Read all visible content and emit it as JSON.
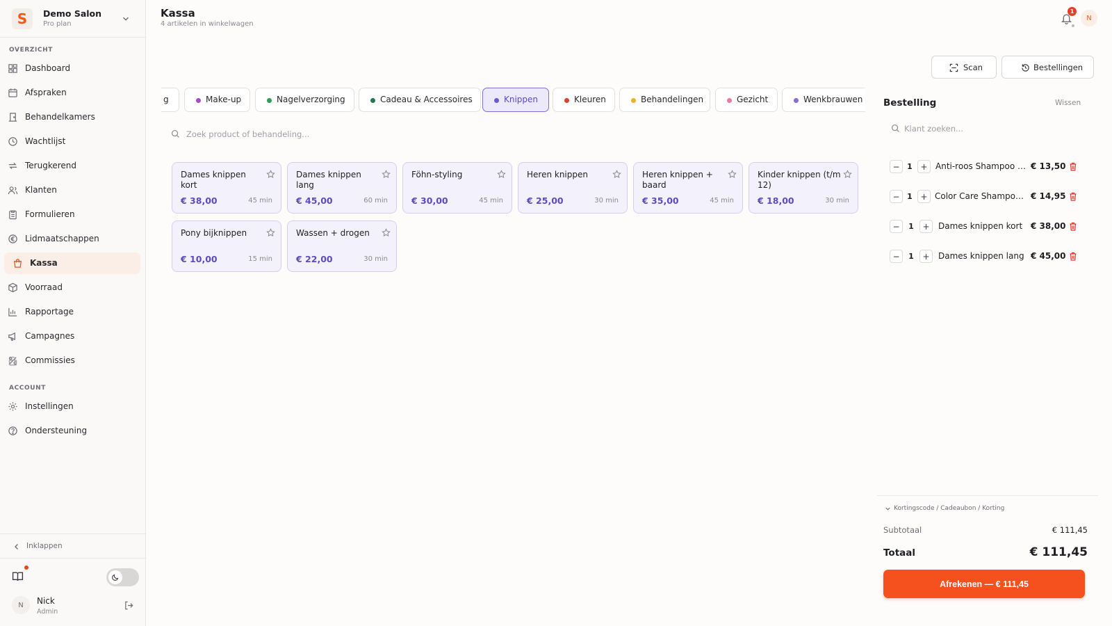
{
  "brand": {
    "logo_letter": "S",
    "name": "Demo Salon",
    "plan": "Pro plan"
  },
  "sidebar": {
    "section_overview": "OVERZICHT",
    "section_account": "ACCOUNT",
    "items": [
      {
        "label": "Dashboard",
        "icon": "dashboard-icon"
      },
      {
        "label": "Afspraken",
        "icon": "calendar-icon"
      },
      {
        "label": "Behandelkamers",
        "icon": "door-icon"
      },
      {
        "label": "Wachtlijst",
        "icon": "clock-icon"
      },
      {
        "label": "Terugkerend",
        "icon": "repeat-icon"
      },
      {
        "label": "Klanten",
        "icon": "users-icon"
      },
      {
        "label": "Formulieren",
        "icon": "clipboard-icon"
      },
      {
        "label": "Lidmaatschappen",
        "icon": "euro-icon"
      },
      {
        "label": "Kassa",
        "icon": "shopping-bag-icon"
      },
      {
        "label": "Voorraad",
        "icon": "package-icon"
      },
      {
        "label": "Rapportage",
        "icon": "bar-chart-icon"
      },
      {
        "label": "Campagnes",
        "icon": "megaphone-icon"
      },
      {
        "label": "Commissies",
        "icon": "percent-icon"
      }
    ],
    "account_items": [
      {
        "label": "Instellingen",
        "icon": "gear-icon"
      },
      {
        "label": "Ondersteuning",
        "icon": "help-icon"
      }
    ],
    "collapse_label": "Inklappen",
    "user": {
      "initial": "N",
      "name": "Nick",
      "role": "Admin"
    }
  },
  "header": {
    "title": "Kassa",
    "subtitle": "4 artikelen in winkelwagen",
    "notification_count": "1",
    "avatar_initial": "N",
    "scan_label": "Scan",
    "orders_label": "Bestellingen"
  },
  "categories": [
    {
      "label": "g",
      "color": ""
    },
    {
      "label": "Make-up",
      "color": "#a64ac9"
    },
    {
      "label": "Nagelverzorging",
      "color": "#2e9b57"
    },
    {
      "label": "Cadeau & Accessoires",
      "color": "#237a4c"
    },
    {
      "label": "Knippen",
      "color": "#6a5ad6"
    },
    {
      "label": "Kleuren",
      "color": "#d9432c"
    },
    {
      "label": "Behandelingen",
      "color": "#e8b223"
    },
    {
      "label": "Gezicht",
      "color": "#e87aa3"
    },
    {
      "label": "Wenkbrauwen &",
      "color": "#8a6ad6"
    }
  ],
  "search": {
    "placeholder": "Zoek product of behandeling..."
  },
  "products": [
    {
      "name": "Dames knippen kort",
      "price": "€ 38,00",
      "duration": "45 min"
    },
    {
      "name": "Dames knippen lang",
      "price": "€ 45,00",
      "duration": "60 min"
    },
    {
      "name": "Föhn-styling",
      "price": "€ 30,00",
      "duration": "45 min"
    },
    {
      "name": "Heren knippen",
      "price": "€ 25,00",
      "duration": "30 min"
    },
    {
      "name": "Heren knippen + baard",
      "price": "€ 35,00",
      "duration": "45 min"
    },
    {
      "name": "Kinder knippen (t/m 12)",
      "price": "€ 18,00",
      "duration": "30 min"
    },
    {
      "name": "Pony bijknippen",
      "price": "€ 10,00",
      "duration": "15 min"
    },
    {
      "name": "Wassen + drogen",
      "price": "€ 22,00",
      "duration": "30 min"
    }
  ],
  "order": {
    "title": "Bestelling",
    "clear_label": "Wissen",
    "customer_placeholder": "Klant zoeken...",
    "lines": [
      {
        "qty": "1",
        "name": "Anti-roos Shampoo 2...",
        "price": "€ 13,50"
      },
      {
        "qty": "1",
        "name": "Color Care Shampoo ...",
        "price": "€ 14,95"
      },
      {
        "qty": "1",
        "name": "Dames knippen kort",
        "price": "€ 38,00"
      },
      {
        "qty": "1",
        "name": "Dames knippen lang",
        "price": "€ 45,00"
      }
    ],
    "discount_label": "Kortingscode / Cadeaubon / Korting",
    "subtotal_label": "Subtotaal",
    "subtotal_value": "€ 111,45",
    "total_label": "Totaal",
    "total_value": "€ 111,45",
    "checkout_label": "Afrekenen — € 111,45"
  },
  "colors": {
    "accent": "#f4511e",
    "active_tab": "#6a5ad6",
    "card_bg": "#f3f1fc",
    "price": "#5b4bc4"
  }
}
